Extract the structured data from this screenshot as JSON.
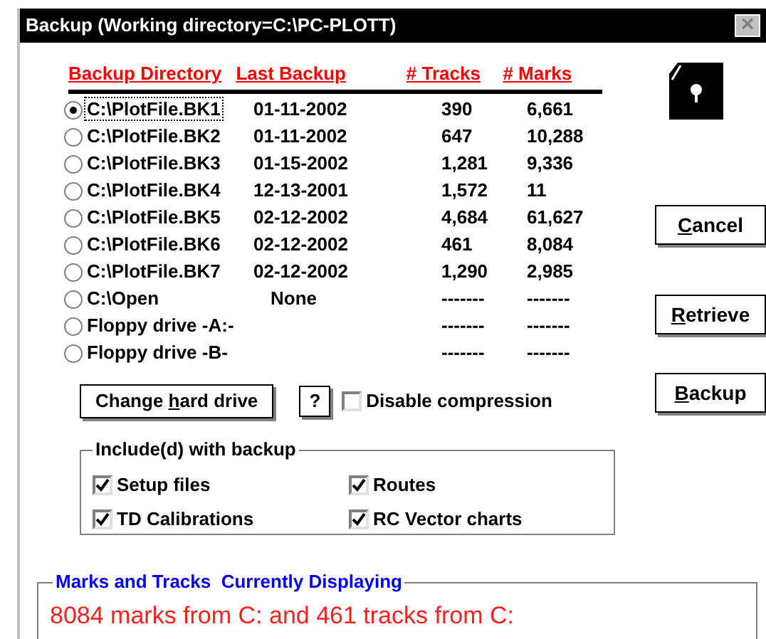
{
  "window": {
    "title": "Backup (Working directory=C:\\PC-PLOTT)",
    "close": "×"
  },
  "columns": [
    "Backup Directory",
    "Last Backup",
    "# Tracks",
    "# Marks"
  ],
  "rows": [
    {
      "directory": "C:\\PlotFile.BK1",
      "last_backup": "01-11-2002",
      "tracks": "390",
      "marks": "6,661",
      "selected": true
    },
    {
      "directory": "C:\\PlotFile.BK2",
      "last_backup": "01-11-2002",
      "tracks": "647",
      "marks": "10,288",
      "selected": false
    },
    {
      "directory": "C:\\PlotFile.BK3",
      "last_backup": "01-15-2002",
      "tracks": "1,281",
      "marks": "9,336",
      "selected": false
    },
    {
      "directory": "C:\\PlotFile.BK4",
      "last_backup": "12-13-2001",
      "tracks": "1,572",
      "marks": "11",
      "selected": false
    },
    {
      "directory": "C:\\PlotFile.BK5",
      "last_backup": "02-12-2002",
      "tracks": "4,684",
      "marks": "61,627",
      "selected": false
    },
    {
      "directory": "C:\\PlotFile.BK6",
      "last_backup": "02-12-2002",
      "tracks": "461",
      "marks": "8,084",
      "selected": false
    },
    {
      "directory": "C:\\PlotFile.BK7",
      "last_backup": "02-12-2002",
      "tracks": "1,290",
      "marks": "2,985",
      "selected": false
    },
    {
      "directory": "C:\\Open",
      "last_backup": "None",
      "tracks": "-------",
      "marks": "-------",
      "selected": false
    },
    {
      "directory": "Floppy drive -A:-",
      "tracks": "-------",
      "marks": "-------",
      "selected": false
    },
    {
      "directory": "Floppy drive -B-",
      "tracks": "-------",
      "marks": "-------",
      "selected": false
    }
  ],
  "side_buttons": [
    {
      "hotkey": "C",
      "after": "ancel"
    },
    {
      "hotkey": "R",
      "after": "etrieve"
    },
    {
      "hotkey": "B",
      "after": "ackup"
    }
  ],
  "change_drive_button": {
    "before": "Change ",
    "hotkey": "h",
    "after": "ard drive"
  },
  "help_button": "?",
  "disable_compression": {
    "label": "Disable compression",
    "checked": false
  },
  "include_group": {
    "title": "Include(d) with backup",
    "options": [
      {
        "label": "Setup files",
        "checked": true
      },
      {
        "label": "Routes",
        "checked": true
      },
      {
        "label": "TD Calibrations",
        "checked": true
      },
      {
        "label": "RC Vector charts",
        "checked": true
      }
    ]
  },
  "status_group": {
    "title": "Marks and Tracks  Currently Displaying",
    "message": "8084 marks from C: and 461 tracks from C:"
  }
}
